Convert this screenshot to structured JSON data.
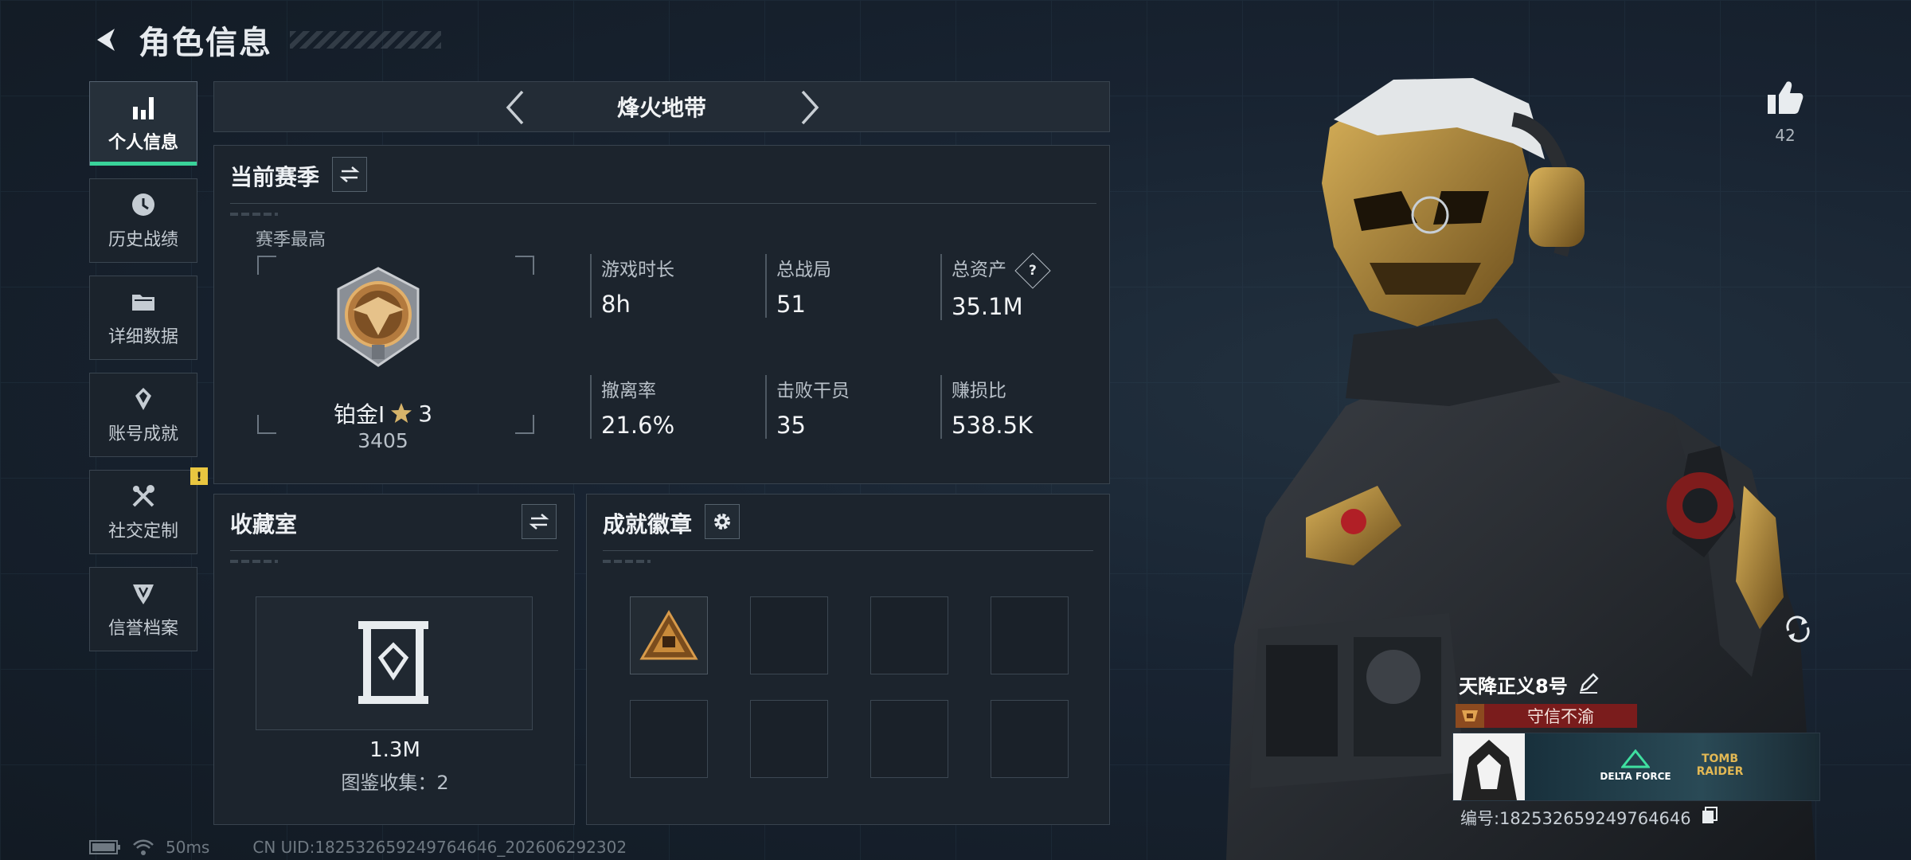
{
  "header": {
    "title": "角色信息"
  },
  "sidebar": {
    "items": [
      {
        "label": "个人信息",
        "icon": "bar-chart-icon",
        "active": true
      },
      {
        "label": "历史战绩",
        "icon": "history-clock-icon",
        "active": false
      },
      {
        "label": "详细数据",
        "icon": "folder-icon",
        "active": false
      },
      {
        "label": "账号成就",
        "icon": "achievement-icon",
        "active": false
      },
      {
        "label": "社交定制",
        "icon": "tools-icon",
        "active": false,
        "badge": "!"
      },
      {
        "label": "信誉档案",
        "icon": "credit-shield-icon",
        "active": false
      }
    ]
  },
  "mode": {
    "title": "烽火地带"
  },
  "season": {
    "title": "当前赛季",
    "best_label": "赛季最高",
    "rank_name": "铂金Ⅰ",
    "rank_stars": "3",
    "rank_score": "3405",
    "stats": [
      {
        "label": "游戏时长",
        "value": "8h"
      },
      {
        "label": "总战局",
        "value": "51"
      },
      {
        "label": "总资产",
        "value": "35.1M",
        "help": "?"
      },
      {
        "label": "撤离率",
        "value": "21.6%"
      },
      {
        "label": "击败干员",
        "value": "35"
      },
      {
        "label": "赚损比",
        "value": "538.5K"
      }
    ]
  },
  "collection": {
    "title": "收藏室",
    "value": "1.3M",
    "subtitle": "图鉴收集：2"
  },
  "achievements": {
    "title": "成就徽章",
    "slots_filled": 1,
    "slots_total": 8
  },
  "profile": {
    "likes": "42",
    "player_name": "天降正义8号",
    "title_tag": "守信不渝",
    "banner_logos": [
      "DELTA FORCE",
      "TOMB RAIDER"
    ],
    "player_id": "编号:182532659249764646"
  },
  "footer": {
    "ping": "50ms",
    "uid": "CN UID:182532659249764646_202606292302"
  },
  "colors": {
    "accent": "#39d39a",
    "warning": "#e9c640",
    "title_tag_bg": "#7a1c1c"
  }
}
